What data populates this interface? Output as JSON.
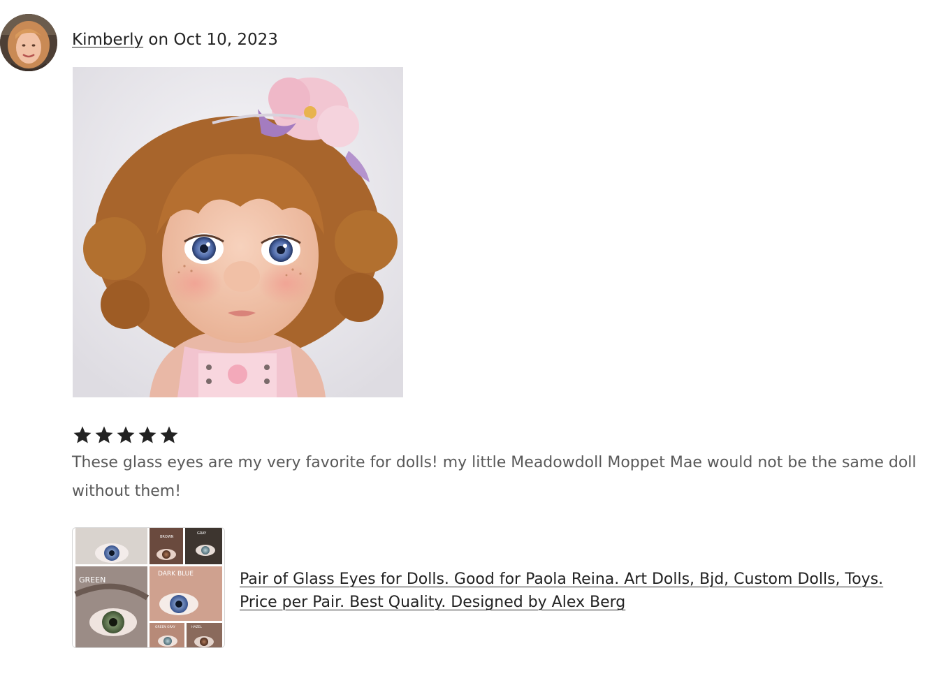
{
  "review": {
    "author": "Kimberly",
    "date_prefix": " on ",
    "date": "Oct 10, 2023",
    "rating": 5,
    "text": "These glass eyes are my very favorite for dolls! my little Meadowdoll Moppet Mae would not be the same doll without them!",
    "listing_title": "Pair of Glass Eyes for Dolls. Good for Paola Reina. Art Dolls, Bjd, Custom Dolls, Toys. Price per Pair. Best Quality. Designed by Alex Berg",
    "thumb_labels": {
      "brown": "BROWN",
      "gray": "GRAY",
      "green": "GREEN",
      "dark_blue": "DARK BLUE",
      "green_gray": "GREEN GRAY",
      "hazel": "HAZEL"
    }
  },
  "colors": {
    "text": "#222222",
    "muted_text": "#595959",
    "star": "#222222"
  }
}
